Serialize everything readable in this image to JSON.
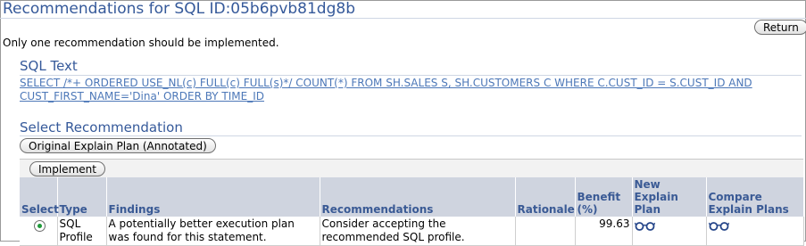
{
  "header": {
    "title": "Recommendations for SQL ID:05b6pvb81dg8b",
    "return_label": "Return"
  },
  "note": "Only one recommendation should be implemented.",
  "sql_text": {
    "section_title": "SQL Text",
    "statement": "SELECT /*+ ORDERED USE_NL(c) FULL(c) FULL(s)*/ COUNT(*) FROM SH.SALES S, SH.CUSTOMERS C WHERE C.CUST_ID = S.CUST_ID AND CUST_FIRST_NAME='Dina' ORDER BY TIME_ID"
  },
  "select_recommendation": {
    "section_title": "Select Recommendation",
    "original_plan_label": "Original Explain Plan (Annotated)",
    "implement_label": "Implement",
    "columns": {
      "select": "Select",
      "type": "Type",
      "findings": "Findings",
      "recommendations": "Recommendations",
      "rationale": "Rationale",
      "benefit": "Benefit (%)",
      "new_plan": "New Explain Plan",
      "compare_plans": "Compare Explain Plans"
    },
    "rows": [
      {
        "selected": true,
        "type": "SQL Profile",
        "findings": "A potentially better execution plan was found for this statement.",
        "recommendations": "Consider accepting the recommended SQL profile.",
        "rationale": "",
        "benefit": "99.63",
        "new_plan_icon": "glasses-icon",
        "compare_icon": "glasses-icon"
      }
    ]
  },
  "colors": {
    "heading": "#35599a",
    "link": "#4d78b8",
    "table_header_bg": "#cfd4df",
    "radio_selected": "#1f9a3a"
  }
}
